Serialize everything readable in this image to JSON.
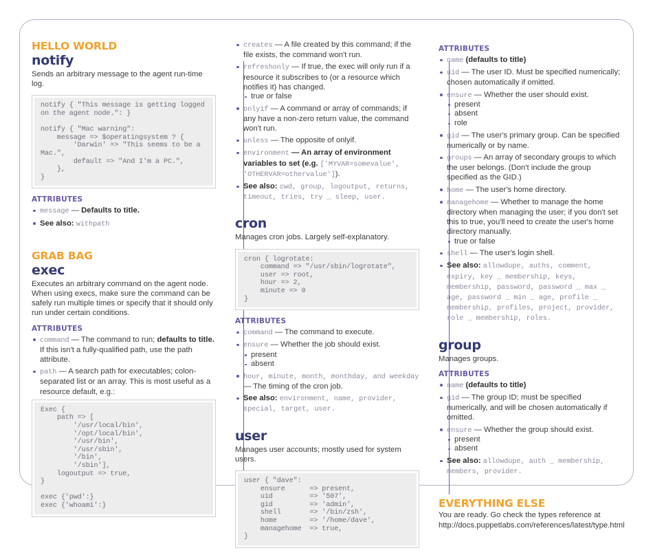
{
  "page": {
    "accent_orange": "#f0a22e",
    "accent_navy": "#343b72",
    "accent_purple": "#6b5aa3",
    "code_bg": "#ededed"
  },
  "col1": {
    "section_title": "HELLO WORLD",
    "notify": {
      "title": "notify",
      "desc": "Sends an arbitrary message to the agent run-time log.",
      "code": "notify { \"This message is getting logged\non the agent node.\": }\n\nnotify { \"Mac warning\":\n    message => $operatingsystem ? {\n        'Darwin' => \"This seems to be a\nMac.\",\n        default => \"And I'm a PC.\",\n    },\n}",
      "attrs_label": "ATTRIBUTES",
      "attrs": [
        {
          "code": "message",
          "text": " — ",
          "bold": "Defaults to title."
        },
        {
          "label": "See also:",
          "code2": "withpath"
        }
      ]
    },
    "section_title2": "GRAB BAG",
    "exec": {
      "title": "exec",
      "desc": "Executes an arbitrary command on the agent node. When using execs, make sure the command can be safely run multiple times or specify that it should only run under certain conditions.",
      "attrs_label": "ATTRIBUTES",
      "attr_command_code": "command",
      "attr_command_text1": " — The command to run; ",
      "attr_command_bold": "defaults to title.",
      "attr_command_text2": " If this isn't a fully-qualified path, use the path attribute.",
      "attr_path_code": "path",
      "attr_path_text": " — A search path for executables; colon-separated list or an array. This is most useful as a resource default, e.g.:",
      "code": "Exec {\n    path => [\n        '/usr/local/bin',\n        '/opt/local/bin',\n        '/usr/bin',\n        '/usr/sbin',\n        '/bin',\n        '/sbin'],\n    logoutput => true,\n}\n\nexec {'pwd':}\nexec {'whoami':}"
    }
  },
  "col2": {
    "exec_attrs_cont": [
      {
        "code": "creates",
        "text": " — A file created by this command; if the file exists, the command won't run."
      },
      {
        "code": "refreshonly",
        "text": " — If true, the exec will only run if a resource it subscribes to (or a resource which notifies it) has changed.",
        "sub": [
          "true or false"
        ]
      },
      {
        "code": "onlyif",
        "text": " — A command or array of commands; if any have a non-zero return value, the command won't run."
      },
      {
        "code": "unless",
        "text": " — The opposite of onlyif."
      },
      {
        "code": "environment",
        "text": " — An array of environment variables to set (e.g. ",
        "code_inline": "['MYVAR=somevalue', 'OTHERVAR=othervalue']",
        "text_after": ")."
      }
    ],
    "exec_seealso_label": "See also:",
    "exec_seealso_code": "cwd, group, logoutput, returns, timeout, tries, try _ sleep, user.",
    "cron": {
      "title": "cron",
      "desc": "Manages cron jobs. Largely self-explanatory.",
      "code": "cron { logrotate:\n    command => \"/usr/sbin/logrotate\",\n    user => root,\n    hour => 2,\n    minute => 0\n}",
      "attrs_label": "ATTRIBUTES",
      "attrs": [
        {
          "code": "command",
          "text": " — The command to execute."
        },
        {
          "code": "ensure",
          "text": " — Whether the job should exist.",
          "sub": [
            "present",
            "absent"
          ]
        },
        {
          "code": "hour, minute, month, monthday, and weekday",
          "text": " — The timing of the cron job."
        }
      ],
      "seealso_label": "See also:",
      "seealso_code": "environment, name, provider, special, target, user."
    },
    "user": {
      "title": "user",
      "desc": "Manages user accounts; mostly used for system users.",
      "code": "user { \"dave\":\n    ensure      => present,\n    uid         => '507',\n    gid         => 'admin',\n    shell       => '/bin/zsh',\n    home        => '/home/dave',\n    managehome  => true,\n}"
    }
  },
  "col3": {
    "user_attrs_label": "ATTRIBUTES",
    "user_attrs": [
      {
        "code": "name",
        "bold": " (defaults to title)"
      },
      {
        "code": "uid",
        "text": " — The user ID. Must be specified numerically; chosen automatically if omitted."
      },
      {
        "code": "ensure",
        "text": " — Whether the user should exist.",
        "sub": [
          "present",
          "absent",
          "role"
        ]
      },
      {
        "code": "gid",
        "text": " — The user's primary group. Can be specified numerically or by name."
      },
      {
        "code": "groups",
        "text": " — An array of secondary groups to which the user belongs. (Don't include the group specified as the GID.)"
      },
      {
        "code": "home",
        "text": " — The user's home directory."
      },
      {
        "code": "managehome",
        "text": " — Whether to manage the home directory when managing the user; if you don't set this to true, you'll need to create the user's home directory manually.",
        "sub": [
          "true or false"
        ]
      },
      {
        "code": "shell",
        "text": " — The user's login shell."
      }
    ],
    "user_seealso_label": "See also:",
    "user_seealso_code": "allowdupe, auths, comment, expiry, key _ membership, keys, membership, password, password _ max _ age, password _ min _ age, profile _ membership, profiles, project, provider, role _ membership, roles.",
    "group": {
      "title": "group",
      "desc": "Manages groups.",
      "attrs_label": "ATTRIBUTES",
      "attrs": [
        {
          "code": "name",
          "bold": " (defaults to title)"
        },
        {
          "code": "gid",
          "text": " — The group ID; must be specified numerically, and will be chosen automatically if omitted."
        },
        {
          "code": "ensure",
          "text": " — Whether the group should exist.",
          "sub": [
            "present",
            "absent"
          ]
        }
      ],
      "seealso_label": "See also:",
      "seealso_code": "allowdupe, auth _ membership, members, provider."
    },
    "everything": {
      "section_title": "EVERYTHING ELSE",
      "line1": "You are ready. Go check the types reference at",
      "line2": "http://docs.puppetlabs.com/references/latest/type.html"
    }
  }
}
